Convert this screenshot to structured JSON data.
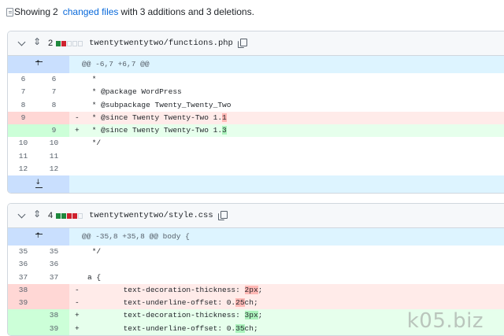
{
  "summary": {
    "prefix": "Showing",
    "count": "2",
    "link_text": "changed files",
    "mid1": "with",
    "additions": "3",
    "mid2": "additions and",
    "deletions": "3",
    "suffix": "deletions."
  },
  "files": [
    {
      "changes": "2",
      "blocks": [
        "add",
        "del",
        "neutral",
        "neutral",
        "neutral"
      ],
      "name": "twentytwentytwo/functions.php",
      "hunk_header": "@@ -6,7 +6,7 @@",
      "lines": [
        {
          "type": "ctx",
          "old": "6",
          "new": "6",
          "sign": "",
          "text": " *"
        },
        {
          "type": "ctx",
          "old": "7",
          "new": "7",
          "sign": "",
          "text": " * @package WordPress"
        },
        {
          "type": "ctx",
          "old": "8",
          "new": "8",
          "sign": "",
          "text": " * @subpackage Twenty_Twenty_Two"
        },
        {
          "type": "del",
          "old": "9",
          "new": "",
          "sign": "-",
          "text": " * @since Twenty Twenty-Two 1.",
          "hl": "1",
          "rest": ""
        },
        {
          "type": "add",
          "old": "",
          "new": "9",
          "sign": "+",
          "text": " * @since Twenty Twenty-Two 1.",
          "hl": "3",
          "rest": ""
        },
        {
          "type": "ctx",
          "old": "10",
          "new": "10",
          "sign": "",
          "text": " */"
        },
        {
          "type": "ctx",
          "old": "11",
          "new": "11",
          "sign": "",
          "text": ""
        },
        {
          "type": "ctx",
          "old": "12",
          "new": "12",
          "sign": "",
          "text": ""
        }
      ]
    },
    {
      "changes": "4",
      "blocks": [
        "add",
        "add",
        "del",
        "del",
        "neutral"
      ],
      "name": "twentytwentytwo/style.css",
      "hunk_header": "@@ -35,8 +35,8 @@ body {",
      "lines": [
        {
          "type": "ctx",
          "old": "35",
          "new": "35",
          "sign": "",
          "text": " */"
        },
        {
          "type": "ctx",
          "old": "36",
          "new": "36",
          "sign": "",
          "text": ""
        },
        {
          "type": "ctx",
          "old": "37",
          "new": "37",
          "sign": "",
          "text": "a {"
        },
        {
          "type": "del",
          "old": "38",
          "new": "",
          "sign": "-",
          "text": "        text-decoration-thickness: ",
          "hl": "2px",
          "rest": ";"
        },
        {
          "type": "del",
          "old": "39",
          "new": "",
          "sign": "-",
          "text": "        text-underline-offset: 0.",
          "hl": "25",
          "rest": "ch;"
        },
        {
          "type": "add",
          "old": "",
          "new": "38",
          "sign": "+",
          "text": "        text-decoration-thickness: ",
          "hl": "3px",
          "rest": ";"
        },
        {
          "type": "add",
          "old": "",
          "new": "39",
          "sign": "+",
          "text": "        text-underline-offset: 0.",
          "hl": "35",
          "rest": "ch;"
        }
      ]
    }
  ],
  "watermark": "k05.biz",
  "colors": {
    "link": "#0969da",
    "add_bg": "#e6ffec",
    "del_bg": "#ffebe9",
    "add_block": "#1f883d",
    "del_block": "#cf222e",
    "hunk_bg": "#ddf4ff"
  }
}
